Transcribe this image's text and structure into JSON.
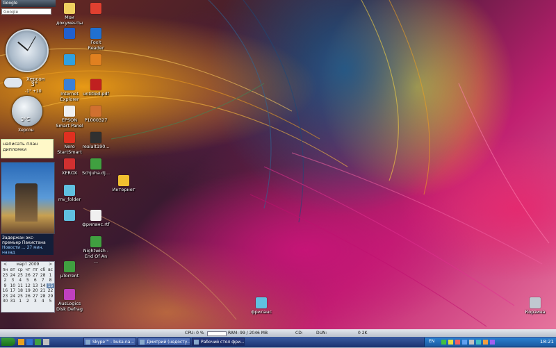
{
  "sidebar": {
    "google_bar": "Google",
    "google_search_label": "Google",
    "weather1": {
      "city": "Херсон",
      "temp": "3°",
      "range": "-1°  +10"
    },
    "weather2": {
      "temp": "3°C",
      "city": "Херсон"
    },
    "note": "написать план дипломки",
    "news": {
      "headline": "Задержан экс-премьер Пакистана",
      "meta": "Новости ... 27 мин. назад"
    },
    "calendar": {
      "month": "март 2009",
      "weekdays": [
        "пн",
        "вт",
        "ср",
        "чт",
        "пт",
        "сб",
        "вс"
      ],
      "rows": [
        [
          "23",
          "24",
          "25",
          "26",
          "27",
          "28",
          "1"
        ],
        [
          "2",
          "3",
          "4",
          "5",
          "6",
          "7",
          "8"
        ],
        [
          "9",
          "10",
          "11",
          "12",
          "13",
          "14",
          "15"
        ],
        [
          "16",
          "17",
          "18",
          "19",
          "20",
          "21",
          "22"
        ],
        [
          "23",
          "24",
          "25",
          "26",
          "27",
          "28",
          "29"
        ],
        [
          "30",
          "31",
          "1",
          "2",
          "3",
          "4",
          "5"
        ]
      ],
      "today": "15"
    }
  },
  "desktop_icons": [
    {
      "label": "Мои документы",
      "color": "#f0d060"
    },
    {
      "label": "",
      "color": "#2060d0"
    },
    {
      "label": "",
      "color": "#30a0e0"
    },
    {
      "label": "Internet Explorer",
      "color": "#3a80d8"
    },
    {
      "label": "EPSON Smart Panel",
      "color": "#f0f0f0"
    },
    {
      "label": "Nero StartSmart",
      "color": "#e03020"
    },
    {
      "label": "XEROX",
      "color": "#d03030"
    },
    {
      "label": "mv_folder",
      "color": "#60c0e0"
    },
    {
      "label": "",
      "color": "#60c0e0"
    },
    {
      "label": "µTorrent",
      "color": "#40a040"
    },
    {
      "label": "AusLogics Disk Defrag",
      "color": "#c040c0"
    },
    {
      "label": "",
      "color": "#e04030"
    },
    {
      "label": "Foxit Reader",
      "color": "#2070d0"
    },
    {
      "label": "",
      "color": "#e08020"
    },
    {
      "label": "untitled.pdf",
      "color": "#c02020"
    },
    {
      "label": "P1000327",
      "color": "#d07030"
    },
    {
      "label": "realalt190...",
      "color": "#303030"
    },
    {
      "label": "Schjuha.dj...",
      "color": "#40a040"
    },
    {
      "label": "фриланс.rtf",
      "color": "#f0f0f0"
    },
    {
      "label": "Nightwish - End Of An ...",
      "color": "#40a040"
    },
    {
      "label": "Интернет",
      "color": "#f0c030"
    },
    {
      "label": "фриланс",
      "color": "#60c0e0"
    },
    {
      "label": "Корзина",
      "color": "#c0c8d0"
    }
  ],
  "statusbar": {
    "cpu": "CPU: 0 %",
    "ram": "RAM: 99 / 2046 MB",
    "cd": "CD:",
    "dun": "DUN:",
    "net": "0 2K"
  },
  "taskbar": {
    "tasks": [
      {
        "label": "Skype™ - buka-na...",
        "active": false
      },
      {
        "label": "Дмитрий (недосту...",
        "active": false
      },
      {
        "label": "Рабочий стол фри...",
        "active": true
      }
    ],
    "lang": "EN",
    "clock": "18:21"
  }
}
